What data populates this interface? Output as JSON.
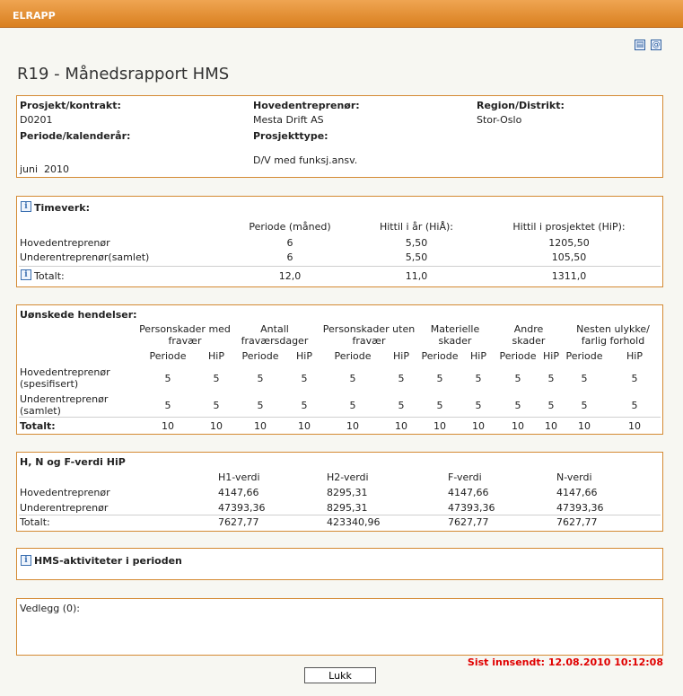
{
  "app": {
    "title": "ELRAPP"
  },
  "toolbar": {
    "print_icon": "printer-icon",
    "email_icon": "email-icon"
  },
  "page": {
    "title": "R19 - Månedsrapport HMS"
  },
  "project": {
    "project_label": "Prosjekt/kontrakt:",
    "project_value": "D0201",
    "contractor_label": "Hovedentreprenør:",
    "contractor_value": "Mesta Drift AS",
    "region_label": "Region/Distrikt:",
    "region_value": "Stor-Oslo",
    "period_label": "Periode/kalenderår:",
    "period_value": "juni  2010",
    "type_label": "Prosjekttype:",
    "type_value": "D/V med funksj.ansv."
  },
  "hours": {
    "title": "Timeverk:",
    "headers": [
      "Periode (måned)",
      "Hittil i år (HiÅ):",
      "Hittil i prosjektet (HiP):"
    ],
    "rows": [
      {
        "label": "Hovedentreprenør",
        "values": [
          "6",
          "5,50",
          "1205,50"
        ]
      },
      {
        "label": "Underentreprenør(samlet)",
        "values": [
          "6",
          "5,50",
          "105,50"
        ]
      }
    ],
    "total": {
      "label": "Totalt:",
      "values": [
        "12,0",
        "11,0",
        "1311,0"
      ]
    }
  },
  "incidents": {
    "title": "Uønskede hendelser:",
    "groups": [
      "Personskader med fravær",
      "Antall fraværsdager",
      "Personskader uten fravær",
      "Materielle skader",
      "Andre skader",
      "Nesten ulykke/ farlig forhold"
    ],
    "sub_period": "Periode",
    "sub_hip": "HiP",
    "rows": [
      {
        "label": "Hovedentreprenør (spesifisert)",
        "values": [
          "5",
          "5",
          "5",
          "5",
          "5",
          "5",
          "5",
          "5",
          "5",
          "5",
          "5",
          "5"
        ]
      },
      {
        "label": "Underentreprenør (samlet)",
        "values": [
          "5",
          "5",
          "5",
          "5",
          "5",
          "5",
          "5",
          "5",
          "5",
          "5",
          "5",
          "5"
        ]
      }
    ],
    "total": {
      "label": "Totalt:",
      "values": [
        "10",
        "10",
        "10",
        "10",
        "10",
        "10",
        "10",
        "10",
        "10",
        "10",
        "10",
        "10"
      ]
    }
  },
  "hnf": {
    "title": "H, N og F-verdi HiP",
    "headers": [
      "H1-verdi",
      "H2-verdi",
      "F-verdi",
      "N-verdi"
    ],
    "rows": [
      {
        "label": "Hovedentreprenør",
        "values": [
          "4147,66",
          "8295,31",
          "4147,66",
          "4147,66"
        ]
      },
      {
        "label": "Underentreprenør",
        "values": [
          "47393,36",
          "8295,31",
          "47393,36",
          "47393,36"
        ]
      }
    ],
    "total": {
      "label": "Totalt:",
      "values": [
        "7627,77",
        "423340,96",
        "7627,77",
        "7627,77"
      ]
    }
  },
  "activities": {
    "title": "HMS-aktiviteter i perioden"
  },
  "attachments": {
    "label": "Vedlegg (0):"
  },
  "status": {
    "last_sent": "Sist innsendt: 12.08.2010 10:12:08"
  },
  "footer": {
    "close_label": "Lukk"
  },
  "colors": {
    "accent": "#d97f1f",
    "border": "#d48a33",
    "alert": "#e00000"
  }
}
